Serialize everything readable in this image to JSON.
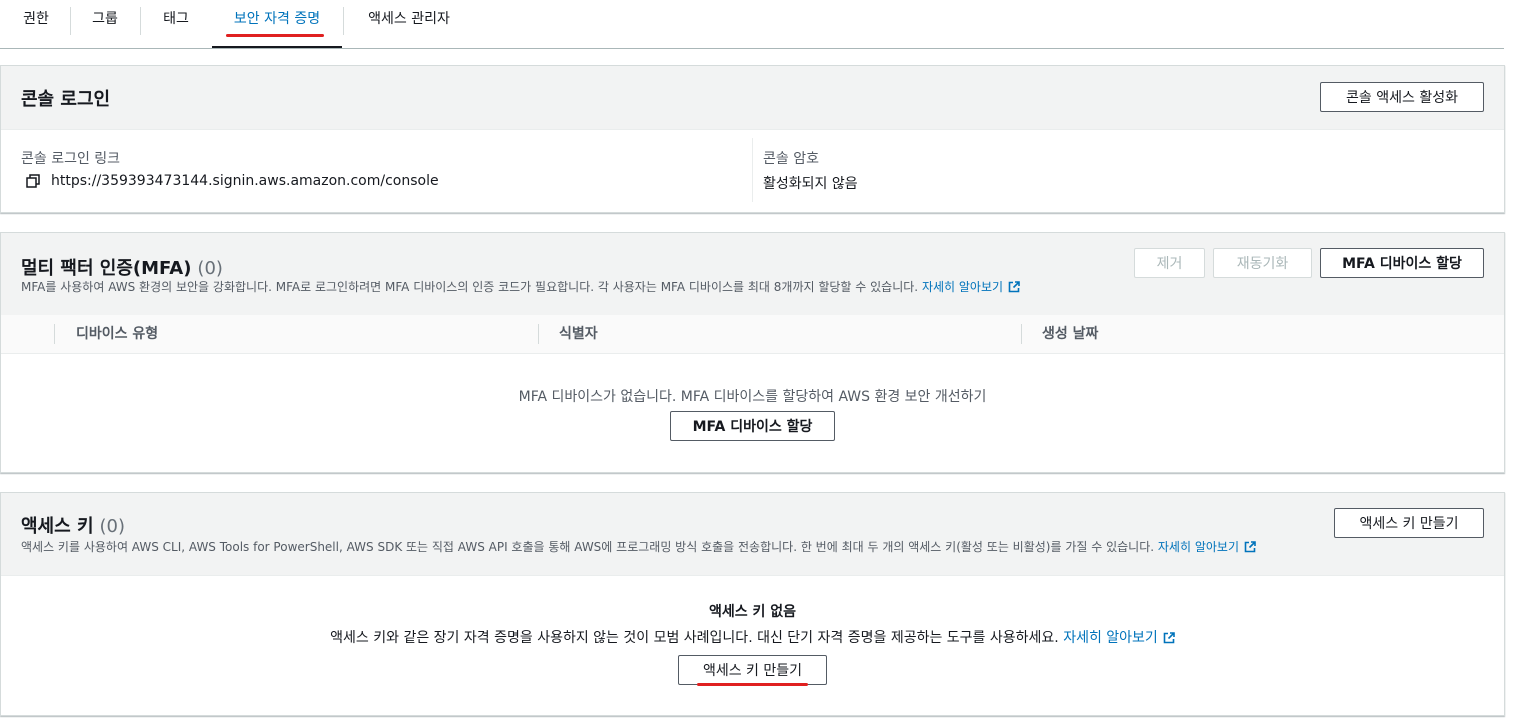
{
  "tabs": [
    {
      "label": "권한"
    },
    {
      "label": "그룹"
    },
    {
      "label": "태그"
    },
    {
      "label": "보안 자격 증명",
      "active": true
    },
    {
      "label": "액세스 관리자"
    }
  ],
  "console_login": {
    "title": "콘솔 로그인",
    "enable_button": "콘솔 액세스 활성화",
    "link_label": "콘솔 로그인 링크",
    "link_value": "https://359393473144.signin.aws.amazon.com/console",
    "password_label": "콘솔 암호",
    "password_value": "활성화되지 않음"
  },
  "mfa": {
    "title": "멀티 팩터 인증(MFA)",
    "count": "(0)",
    "description": "MFA를 사용하여 AWS 환경의 보안을 강화합니다. MFA로 로그인하려면 MFA 디바이스의 인증 코드가 필요합니다. 각 사용자는 MFA 디바이스를 최대 8개까지 할당할 수 있습니다.",
    "learn_more": "자세히 알아보기",
    "remove_button": "제거",
    "resync_button": "재동기화",
    "assign_button": "MFA 디바이스 할당",
    "columns": [
      "디바이스 유형",
      "식별자",
      "생성 날짜"
    ],
    "empty_text": "MFA 디바이스가 없습니다. MFA 디바이스를 할당하여 AWS 환경 보안 개선하기",
    "empty_button": "MFA 디바이스 할당"
  },
  "access_keys": {
    "title": "액세스 키",
    "count": "(0)",
    "description": "액세스 키를 사용하여 AWS CLI, AWS Tools for PowerShell, AWS SDK 또는 직접 AWS API 호출을 통해 AWS에 프로그래밍 방식 호출을 전송합니다. 한 번에 최대 두 개의 액세스 키(활성 또는 비활성)를 가질 수 있습니다.",
    "learn_more": "자세히 알아보기",
    "create_button": "액세스 키 만들기",
    "empty_title": "액세스 키 없음",
    "empty_text": "액세스 키와 같은 장기 자격 증명을 사용하지 않는 것이 모범 사례입니다. 대신 단기 자격 증명을 제공하는 도구를 사용하세요.",
    "empty_learn_more": "자세히 알아보기",
    "empty_button": "액세스 키 만들기"
  },
  "colors": {
    "link": "#0073bb",
    "annotation": "#e02020"
  },
  "icons": {
    "copy": "copy-icon",
    "external": "external-link-icon"
  }
}
